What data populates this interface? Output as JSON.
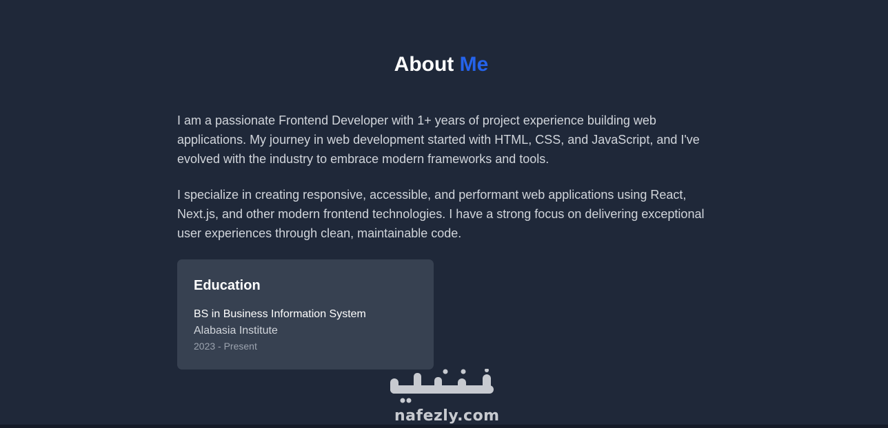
{
  "about": {
    "title_main": "About",
    "title_accent": "Me",
    "paragraphs": [
      "I am a passionate Frontend Developer with 1+ years of project experience building web applications. My journey in web development started with HTML, CSS, and JavaScript, and I've evolved with the industry to embrace modern frameworks and tools.",
      "I specialize in creating responsive, accessible, and performant web applications using React, Next.js, and other modern frontend technologies. I have a strong focus on delivering exceptional user experiences through clean, maintainable code."
    ]
  },
  "education": {
    "heading": "Education",
    "degree": "BS in Business Information System",
    "school": "Alabasia Institute",
    "period": "2023 - Present"
  },
  "watermark": {
    "arabic": "نفذلي",
    "domain": "nafezly.com"
  },
  "colors": {
    "background": "#1f2839",
    "accent": "#2563eb",
    "card": "#374151"
  }
}
